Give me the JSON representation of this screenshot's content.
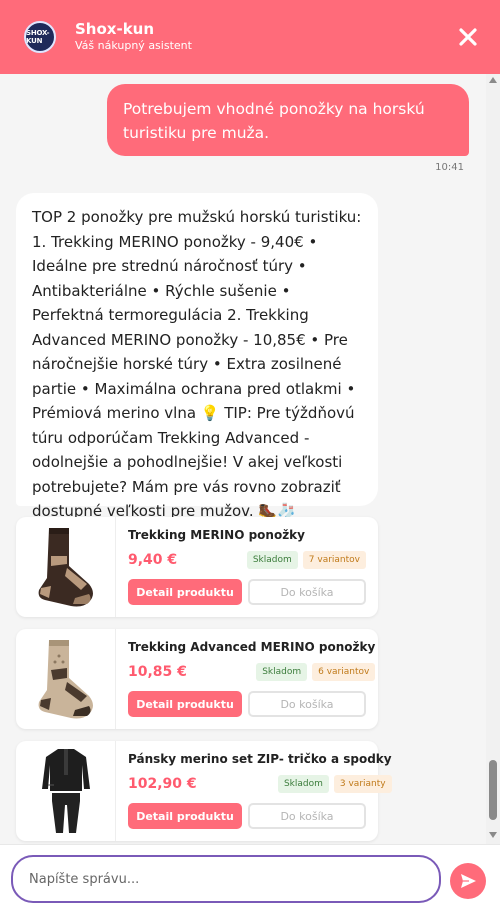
{
  "header": {
    "avatar_text": "SHOX-KUN",
    "title": "Shox-kun",
    "subtitle": "Váš nákupný asistent"
  },
  "messages": {
    "user": {
      "text": "Potrebujem vhodné ponožky na horskú turistiku pre muža.",
      "time": "10:41"
    },
    "bot": {
      "text": "TOP 2 ponožky pre mužskú horskú turistiku: 1. Trekking MERINO ponožky - 9,40€ • Ideálne pre strednú náročnosť túry • Antibakteriálne • Rýchle sušenie • Perfektná termoregulácia 2. Trekking Advanced MERINO ponožky - 10,85€ • Pre náročnejšie horské túry • Extra zosilnené partie • Maximálna ochrana pred otlakmi • Prémiová merino vlna 💡 TIP: Pre týždňovú túru odporúčam Trekking Advanced - odolnejšie a pohodlnejšie! V akej veľkosti potrebujete? Mám pre vás rovno zobraziť dostupné veľkosti pre mužov. 🥾🧦"
    }
  },
  "products": [
    {
      "name": "Trekking MERINO ponožky",
      "price": "9,40 €",
      "stock": "Skladom",
      "variants": "7 variantov",
      "detail_label": "Detail produktu",
      "cart_label": "Do košíka",
      "image_icon": "sock-dark-icon"
    },
    {
      "name": "Trekking Advanced MERINO ponožky",
      "price": "10,85 €",
      "stock": "Skladom",
      "variants": "6 variantov",
      "detail_label": "Detail produktu",
      "cart_label": "Do košíka",
      "image_icon": "sock-beige-icon"
    },
    {
      "name": "Pánsky merino set ZIP- tričko a spodky",
      "price": "102,90 €",
      "stock": "Skladom",
      "variants": "3 varianty",
      "detail_label": "Detail produktu",
      "cart_label": "Do košíka",
      "image_icon": "base-layer-set-icon"
    }
  ],
  "input": {
    "placeholder": "Napíšte správu..."
  },
  "colors": {
    "accent": "#ff6b7a",
    "input_border": "#7a5ab8",
    "chat_bg": "#f5f5f5"
  }
}
